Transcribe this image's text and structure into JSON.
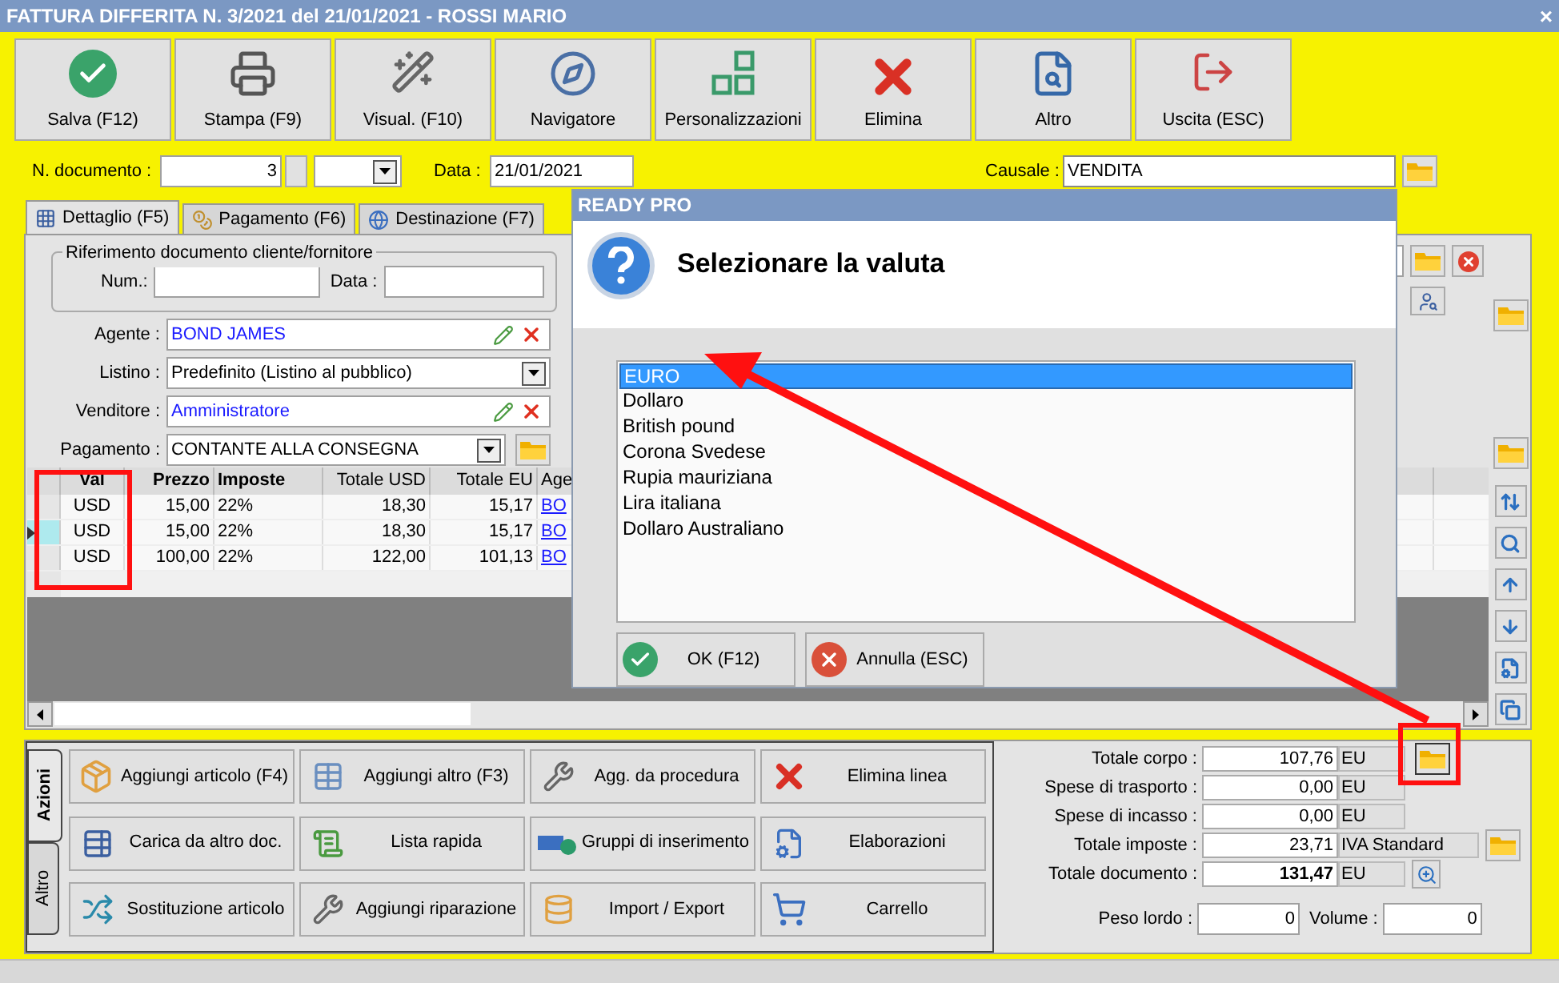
{
  "window": {
    "title": "FATTURA DIFFERITA N. 3/2021 del 21/01/2021 - ROSSI MARIO",
    "close": "×"
  },
  "toolbar": [
    {
      "label": "Salva (F12)",
      "kind": "check"
    },
    {
      "label": "Stampa (F9)",
      "kind": "printer"
    },
    {
      "label": "Visual. (F10)",
      "kind": "wand"
    },
    {
      "label": "Navigatore",
      "kind": "compass"
    },
    {
      "label": "Personalizzazioni",
      "kind": "squares"
    },
    {
      "label": "Elimina",
      "kind": "cross"
    },
    {
      "label": "Altro",
      "kind": "book"
    },
    {
      "label": "Uscita (ESC)",
      "kind": "exit"
    }
  ],
  "document": {
    "number_label": "N. documento :",
    "number": "3",
    "date_label": "Data :",
    "date": "21/01/2021",
    "causale_label": "Causale :",
    "causale": "VENDITA"
  },
  "tabs": [
    {
      "label": "Dettaglio (F5)",
      "kind": "grid",
      "selected": true
    },
    {
      "label": "Pagamento (F6)",
      "kind": "coins",
      "selected": false
    },
    {
      "label": "Destinazione (F7)",
      "kind": "globe",
      "selected": false
    }
  ],
  "reference": {
    "title": "Riferimento documento cliente/fornitore",
    "num_label": "Num.:",
    "date_label": "Data :"
  },
  "fields": [
    {
      "label": "Agente :",
      "value": "BOND JAMES",
      "kind": "link"
    },
    {
      "label": "Listino :",
      "value": "Predefinito (Listino al pubblico)",
      "kind": "dropdown"
    },
    {
      "label": "Venditore :",
      "value": "Amministratore",
      "kind": "link"
    },
    {
      "label": "Pagamento :",
      "value": "CONTANTE ALLA CONSEGNA",
      "kind": "dropdown-folder"
    }
  ],
  "table": {
    "columns": [
      {
        "label": "Val",
        "bold": true
      },
      {
        "label": "Prezzo",
        "bold": true
      },
      {
        "label": "Imposte",
        "bold": true
      },
      {
        "label": "Totale USD",
        "bold": false
      },
      {
        "label": "Totale EU",
        "bold": false
      },
      {
        "label": "Age",
        "bold": false
      }
    ],
    "rows": [
      {
        "cells": [
          "USD",
          "15,00",
          "22%",
          "18,30",
          "15,17",
          "BO"
        ],
        "selected": false
      },
      {
        "cells": [
          "USD",
          "15,00",
          "22%",
          "18,30",
          "15,17",
          "BO"
        ],
        "selected": true
      },
      {
        "cells": [
          "USD",
          "100,00",
          "22%",
          "122,00",
          "101,13",
          "BO"
        ],
        "selected": false
      }
    ]
  },
  "actions": {
    "tabs": [
      {
        "label": "Azioni",
        "selected": true
      },
      {
        "label": "Altro",
        "selected": false
      }
    ],
    "buttons": [
      {
        "label": "Aggiungi articolo (F4)",
        "kind": "box-add"
      },
      {
        "label": "Aggiungi altro (F3)",
        "kind": "table"
      },
      {
        "label": "Agg. da procedura",
        "kind": "wrench"
      },
      {
        "label": "Elimina linea",
        "kind": "cross"
      },
      {
        "label": "Carica da altro doc.",
        "kind": "table-check"
      },
      {
        "label": "Lista rapida",
        "kind": "scroll-add"
      },
      {
        "label": "Gruppi di inserimento",
        "kind": "bar-add"
      },
      {
        "label": "Elaborazioni",
        "kind": "file-gear"
      },
      {
        "label": "Sostituzione articolo",
        "kind": "swap"
      },
      {
        "label": "Aggiungi riparazione",
        "kind": "wrench"
      },
      {
        "label": "Import / Export",
        "kind": "import"
      },
      {
        "label": "Carrello",
        "kind": "cart"
      }
    ]
  },
  "totals": [
    {
      "label": "Totale corpo :",
      "value": "107,76",
      "unit": "EU",
      "bold": false,
      "kind": "folder"
    },
    {
      "label": "Spese di trasporto :",
      "value": "0,00",
      "unit": "EU",
      "bold": false,
      "kind": "none"
    },
    {
      "label": "Spese di incasso :",
      "value": "0,00",
      "unit": "EU",
      "bold": false,
      "kind": "none"
    },
    {
      "label": "Totale imposte :",
      "value": "23,71",
      "unit": "IVA Standard",
      "bold": false,
      "kind": "folder-wide"
    },
    {
      "label": "Totale documento :",
      "value": "131,47",
      "unit": "EU",
      "bold": true,
      "kind": "zoom"
    }
  ],
  "weights": {
    "peso_label": "Peso lordo :",
    "peso": "0",
    "volume_label": "Volume :",
    "volume": "0"
  },
  "dialog": {
    "title": "READY PRO",
    "question": "Selezionare la valuta",
    "options": [
      {
        "label": "EURO",
        "selected": true
      },
      {
        "label": "Dollaro",
        "selected": false
      },
      {
        "label": "British pound",
        "selected": false
      },
      {
        "label": "Corona Svedese",
        "selected": false
      },
      {
        "label": "Rupia mauriziana",
        "selected": false
      },
      {
        "label": "Lira italiana",
        "selected": false
      },
      {
        "label": "Dollaro Australiano",
        "selected": false
      }
    ],
    "buttons": [
      {
        "label": "OK (F12)",
        "kind": "ok"
      },
      {
        "label": "Annulla (ESC)",
        "kind": "cancel"
      }
    ]
  }
}
